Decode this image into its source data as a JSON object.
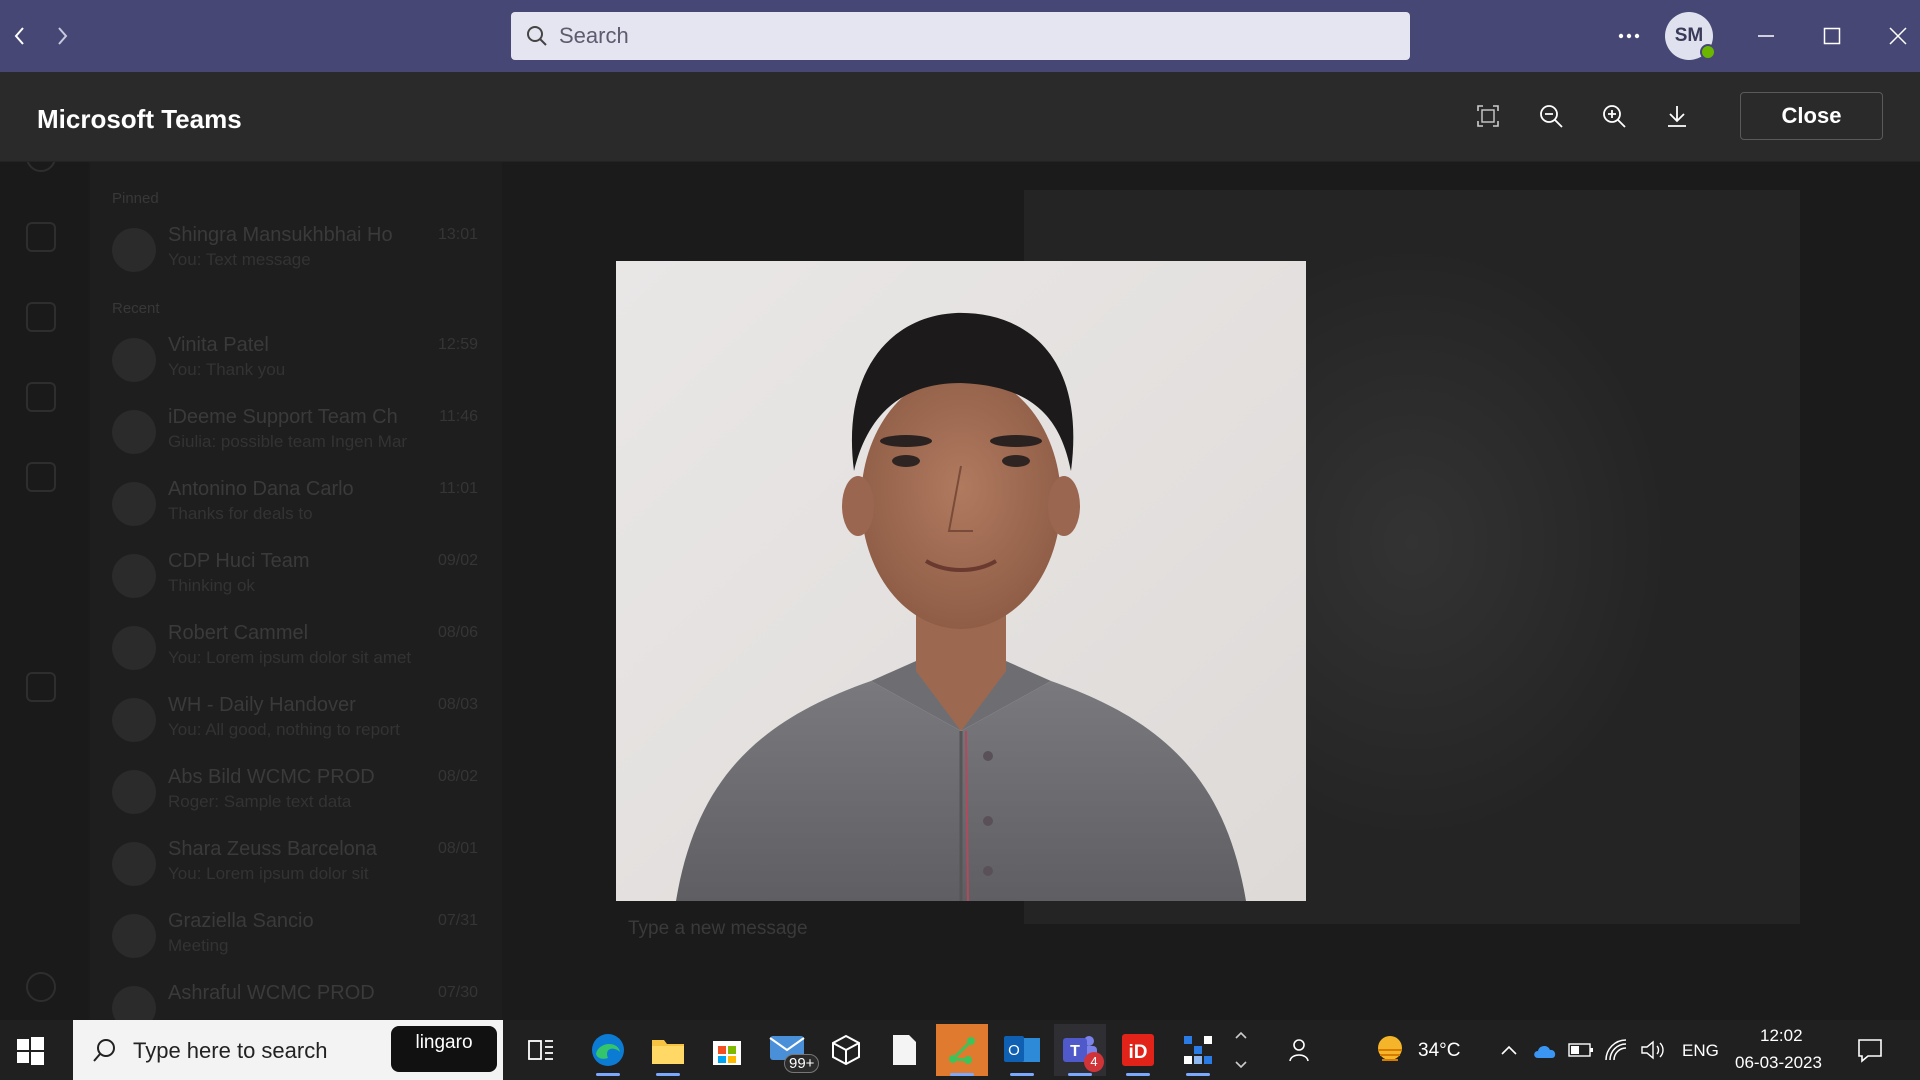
{
  "titlebar": {
    "search_placeholder": "Search",
    "avatar_initials": "SM"
  },
  "viewer": {
    "app_name": "Microsoft Teams",
    "close_label": "Close"
  },
  "background": {
    "sections": [
      "Pinned",
      "Recent"
    ],
    "chats": [
      {
        "name": "Shingra Mansukhbhai Ho",
        "preview": "You: Text message",
        "time": "13:01"
      },
      {
        "name": "Vinita Patel",
        "preview": "You: Thank you",
        "time": "12:59"
      },
      {
        "name": "iDeeme Support Team Ch",
        "preview": "Giulia: possible team Ingen Mar",
        "time": "11:46"
      },
      {
        "name": "Antonino Dana Carlo",
        "preview": "Thanks for deals to",
        "time": "11:01"
      },
      {
        "name": "CDP Huci Team",
        "preview": "Thinking ok",
        "time": "09/02"
      },
      {
        "name": "Robert Cammel",
        "preview": "You: Lorem ipsum dolor sit amet",
        "time": "08/06"
      },
      {
        "name": "WH - Daily Handover",
        "preview": "You: All good, nothing to report",
        "time": "08/03"
      },
      {
        "name": "Abs Bild WCMC PROD",
        "preview": "Roger: Sample text data",
        "time": "08/02"
      },
      {
        "name": "Shara Zeuss Barcelona",
        "preview": "You: Lorem ipsum dolor sit",
        "time": "08/01"
      },
      {
        "name": "Graziella Sancio",
        "preview": "Meeting",
        "time": "07/31"
      },
      {
        "name": "Ashraful WCMC PROD",
        "preview": "",
        "time": "07/30"
      }
    ],
    "compose_placeholder": "Type a new message"
  },
  "taskbar": {
    "search_text": "Type here to search",
    "badge_text": "lingaro",
    "mail_count": "99+",
    "teams_count": "4",
    "temperature": "34°C",
    "language": "ENG",
    "time": "12:02",
    "date": "06-03-2023"
  },
  "colors": {
    "titlebar": "#464775",
    "viewer_header": "#2a2a2a",
    "presence": "#6bb700"
  }
}
